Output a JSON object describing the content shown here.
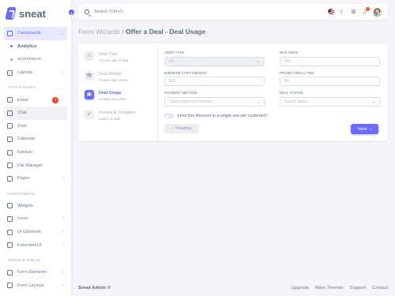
{
  "brand": {
    "name": "sneat"
  },
  "sidebar": {
    "items": [
      {
        "label": "Dashboards",
        "icon": "home-icon"
      },
      {
        "label": "Analytics"
      },
      {
        "label": "eCommerce"
      },
      {
        "label": "Layouts",
        "icon": "layout-icon"
      }
    ],
    "section_apps": "APPS & PAGES",
    "apps": [
      {
        "label": "Email",
        "icon": "mail-icon",
        "badge": "4"
      },
      {
        "label": "Chat",
        "icon": "chat-icon"
      },
      {
        "label": "Todo",
        "icon": "checklist-icon"
      },
      {
        "label": "Calendar",
        "icon": "calendar-icon"
      },
      {
        "label": "Kanban",
        "icon": "grid-icon"
      },
      {
        "label": "File Manager",
        "icon": "folder-icon"
      },
      {
        "label": "Pages",
        "icon": "file-icon"
      }
    ],
    "section_components": "COMPONENTS",
    "components": [
      {
        "label": "Widgets",
        "icon": "widget-icon"
      },
      {
        "label": "Icons",
        "icon": "icons-icon"
      },
      {
        "label": "UI Elements",
        "icon": "ui-icon"
      },
      {
        "label": "Extended UI",
        "icon": "extended-icon"
      }
    ],
    "section_forms": "FORMS & TABLES",
    "forms": [
      {
        "label": "Form Elements",
        "icon": "form-icon"
      },
      {
        "label": "Form Layouts",
        "icon": "form-layout-icon"
      }
    ]
  },
  "navbar": {
    "search_placeholder": "Search (Ctrl+/)",
    "notifications_count": "4"
  },
  "page": {
    "breadcrumb": "Form Wizards /",
    "title": "Offer a Deal - Deal Usage"
  },
  "wizard": {
    "steps": [
      {
        "title": "Deal Type",
        "subtitle": "Choose type of deal",
        "icon": "tag-icon"
      },
      {
        "title": "Deal Details",
        "subtitle": "Provide deal details",
        "icon": "details-icon"
      },
      {
        "title": "Deal Usage",
        "subtitle": "Limitations & offers",
        "icon": "usage-icon"
      },
      {
        "title": "Review & Complete",
        "subtitle": "Launch a deal!",
        "icon": "rocket-icon"
      }
    ],
    "active_step": 2,
    "fields": {
      "user_type": {
        "label": "USER TYPE",
        "value": "All"
      },
      "max_users": {
        "label": "MAX USES",
        "placeholder": "500"
      },
      "min_cart": {
        "label": "MINIMUM CART AMOUNT",
        "placeholder": "$25"
      },
      "promo_fee": {
        "label": "PROMOTIONAL FEE",
        "placeholder": "$4"
      },
      "payment": {
        "label": "PAYMENT METHOD",
        "value": "Select payment method"
      },
      "status": {
        "label": "DEAL STATUS",
        "value": "Select status"
      }
    },
    "toggle_label": "Limit this discount to a single-use per customer?",
    "prev_label": "Previous",
    "next_label": "Next"
  },
  "footer": {
    "brand": "Sneat Admin ©",
    "links": [
      "Upgrade",
      "More Themes",
      "Support",
      "Contact"
    ]
  },
  "colors": {
    "primary": "#696cff",
    "danger": "#ff3e1d",
    "text": "#566a7f"
  }
}
